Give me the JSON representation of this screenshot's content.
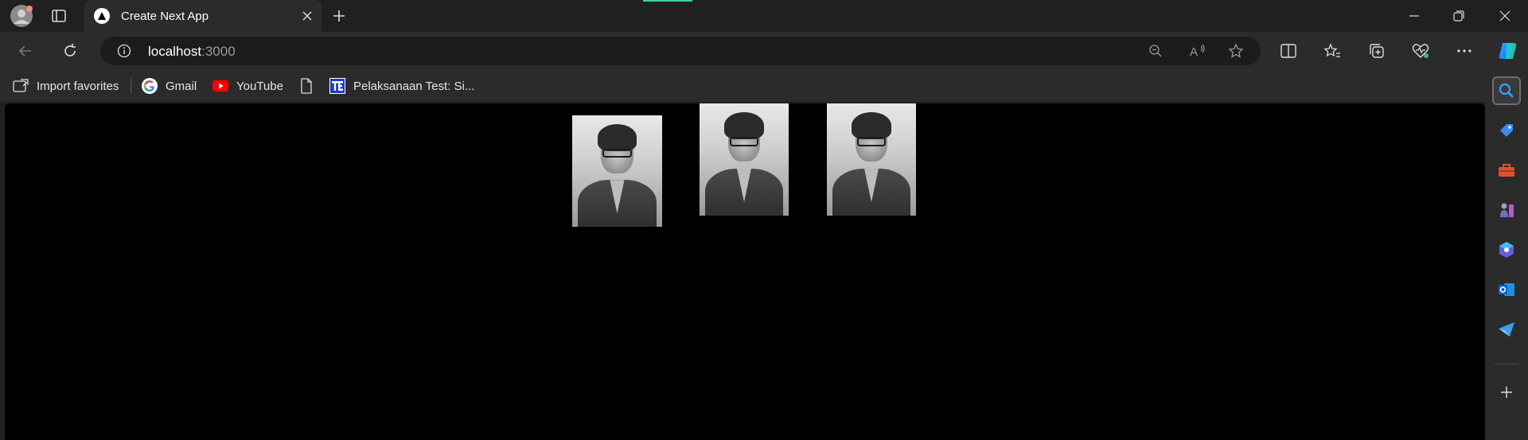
{
  "browser": {
    "tab": {
      "title": "Create Next App"
    },
    "address": {
      "host": "localhost",
      "port": ":3000"
    },
    "bookmarks": [
      {
        "label": "Import favorites",
        "icon": "import-favorites-icon"
      },
      {
        "label": "Gmail",
        "icon": "google-icon"
      },
      {
        "label": "YouTube",
        "icon": "youtube-icon"
      },
      {
        "label": "",
        "icon": "document-icon"
      },
      {
        "label": "Pelaksanaan Test: Si...",
        "icon": "te-site-icon"
      }
    ],
    "sidebar_icons": [
      "search-icon",
      "tag-icon",
      "toolbox-icon",
      "chess-icon",
      "copilot-icon",
      "outlook-icon",
      "send-icon",
      "add-icon"
    ]
  },
  "page": {
    "images": [
      {
        "alt": "portrait photo 1"
      },
      {
        "alt": "portrait photo 2"
      },
      {
        "alt": "portrait photo 3"
      }
    ]
  },
  "colors": {
    "background": "#000000",
    "chrome": "#2b2b2b",
    "titlebar": "#202020"
  }
}
